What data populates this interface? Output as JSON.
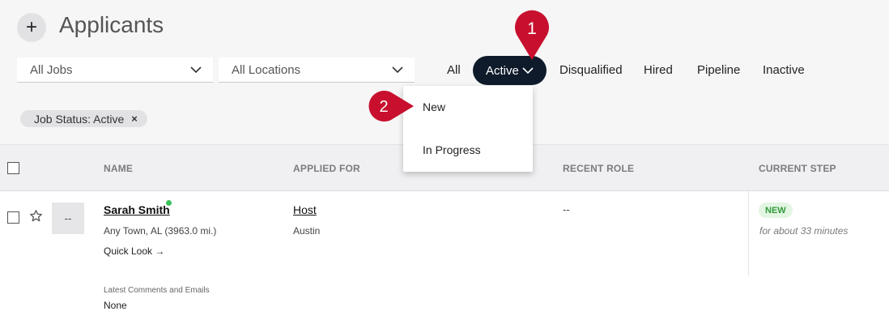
{
  "header": {
    "add_icon": "plus-icon",
    "title": "Applicants"
  },
  "filters": {
    "jobs_select": "All Jobs",
    "locations_select": "All Locations",
    "tabs": [
      "All",
      "Active",
      "Disqualified",
      "Hired",
      "Pipeline",
      "Inactive"
    ],
    "active_tab": "Active"
  },
  "chip": {
    "label": "Job Status: Active",
    "remove_glyph": "×"
  },
  "dropdown": {
    "items": [
      "New",
      "In Progress"
    ]
  },
  "callouts": {
    "first": "1",
    "second": "2",
    "color": "#c8102e"
  },
  "table": {
    "columns": [
      "NAME",
      "APPLIED FOR",
      "RECENT ROLE",
      "CURRENT STEP"
    ],
    "rows": [
      {
        "avatar": "--",
        "name": "Sarah Smith",
        "location": "Any Town, AL (3963.0 mi.)",
        "quick_look": "Quick Look →",
        "applied_for": "Host",
        "applied_city": "Austin",
        "recent_role": "--",
        "step_badge": "NEW",
        "step_time": "for about 33 minutes",
        "comments_label": "Latest Comments and Emails",
        "comments_value": "None"
      }
    ]
  },
  "colors": {
    "active_tab_bg": "#0f1b2b",
    "badge_text": "#2f9a3a",
    "online_dot": "#3cc15a"
  }
}
